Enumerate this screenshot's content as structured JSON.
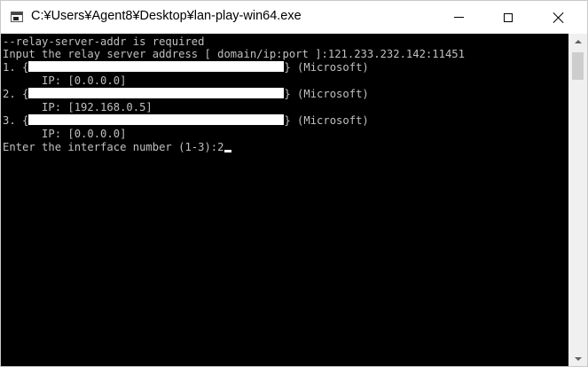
{
  "window": {
    "title": "C:¥Users¥Agent8¥Desktop¥lan-play-win64.exe",
    "background_color": "#000000",
    "text_color": "#c0c0c0"
  },
  "controls": {
    "minimize_icon": "minimize-icon",
    "maximize_icon": "maximize-icon",
    "close_icon": "close-icon"
  },
  "console": {
    "lines": [
      "--relay-server-addr is required",
      "Input the relay server address [ domain/ip:port ]:121.233.232.142:11451"
    ],
    "interfaces": [
      {
        "index": "1. ",
        "open": "{",
        "close": "} (Microsoft)",
        "ip": "      IP: [0.0.0.0]"
      },
      {
        "index": "2. ",
        "open": "{",
        "close": "} (Microsoft)",
        "ip": "      IP: [192.168.0.5]"
      },
      {
        "index": "3. ",
        "open": "{",
        "close": "} (Microsoft)",
        "ip": "      IP: [0.0.0.0]"
      }
    ],
    "prompt": "Enter the interface number (1-3):2"
  }
}
